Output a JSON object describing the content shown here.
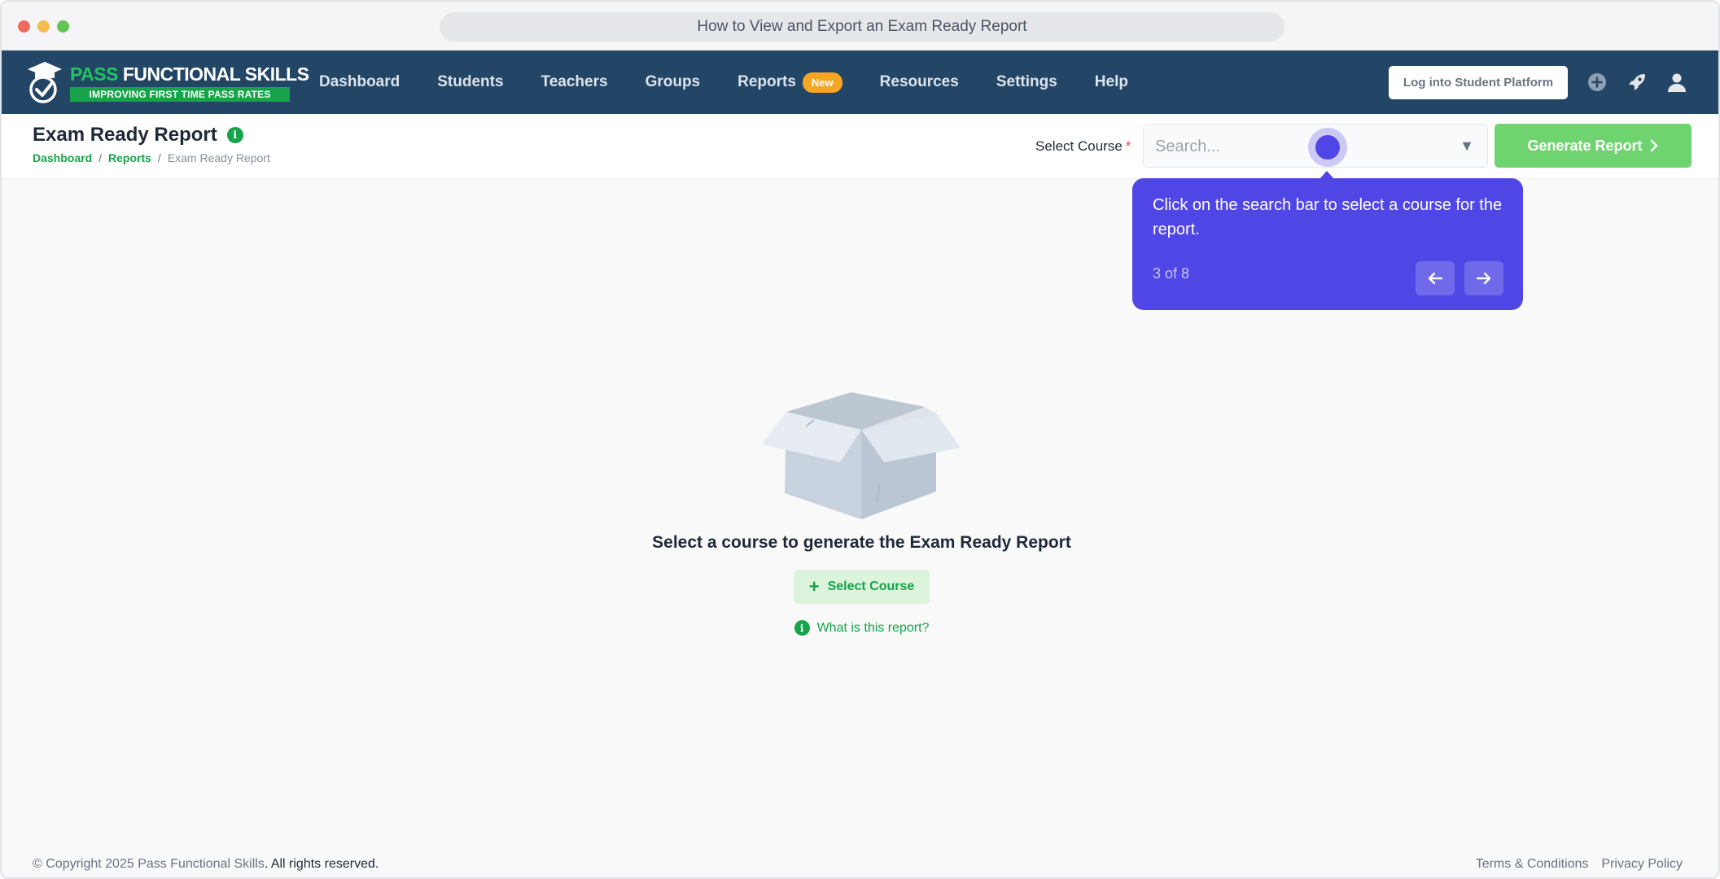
{
  "window": {
    "url_title": "How to View and Export an Exam Ready Report"
  },
  "brand": {
    "pass": "PASS",
    "rest": " FUNCTIONAL SKILLS",
    "tagline": "IMPROVING FIRST TIME PASS RATES"
  },
  "nav": {
    "items": [
      {
        "label": "Dashboard"
      },
      {
        "label": "Students"
      },
      {
        "label": "Teachers"
      },
      {
        "label": "Groups"
      },
      {
        "label": "Reports",
        "badge": "New"
      },
      {
        "label": "Resources"
      },
      {
        "label": "Settings"
      },
      {
        "label": "Help"
      }
    ],
    "login_label": "Log into Student Platform"
  },
  "header": {
    "title": "Exam Ready Report",
    "breadcrumb": {
      "home": "Dashboard",
      "parent": "Reports",
      "current": "Exam Ready Report",
      "sep": "/"
    },
    "course_label": "Select Course",
    "required_mark": "*",
    "search_placeholder": "Search...",
    "caret": "▼",
    "generate_label": "Generate Report"
  },
  "tooltip": {
    "text": "Click on the search bar to select a course for the report.",
    "step": "3 of 8"
  },
  "empty_state": {
    "title": "Select a course to generate the Exam Ready Report",
    "button_label": "Select Course",
    "help_link": "What is this report?"
  },
  "footer": {
    "copyright": "© Copyright 2025 Pass Functional Skills",
    "rights": ". All rights reserved.",
    "terms": "Terms & Conditions",
    "privacy": "Privacy Policy"
  },
  "colors": {
    "navbar": "#234666",
    "accent_green": "#16a34a",
    "tour": "#5046e5",
    "badge": "#f5a623"
  }
}
